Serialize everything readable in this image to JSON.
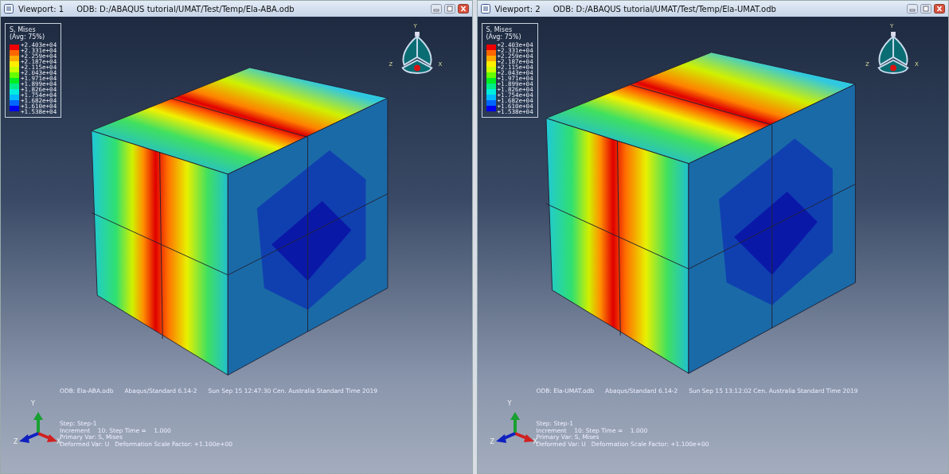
{
  "viewports": [
    {
      "title": "Viewport: 1",
      "odb_path": "ODB: D:/ABAQUS tutorial/UMAT/Test/Temp/Ela-ABA.odb",
      "legend": {
        "title": "S, Mises",
        "subtitle": "(Avg: 75%)",
        "bands": [
          {
            "color": "#ee0000"
          },
          {
            "color": "#ff6600"
          },
          {
            "color": "#ffaa00"
          },
          {
            "color": "#ffee00"
          },
          {
            "color": "#ccff00"
          },
          {
            "color": "#66ff00"
          },
          {
            "color": "#00ee22"
          },
          {
            "color": "#00ee88"
          },
          {
            "color": "#00eedd"
          },
          {
            "color": "#00bbff"
          },
          {
            "color": "#0066ff"
          },
          {
            "color": "#0000ee"
          }
        ],
        "values": [
          "+2.403e+04",
          "+2.331e+04",
          "+2.259e+04",
          "+2.187e+04",
          "+2.115e+04",
          "+2.043e+04",
          "+1.971e+04",
          "+1.899e+04",
          "+1.826e+04",
          "+1.754e+04",
          "+1.682e+04",
          "+1.610e+04",
          "+1.538e+04"
        ]
      },
      "view_cube": {
        "y": "Y",
        "z": "Z",
        "x": "X"
      },
      "info_line": [
        "ODB: Ela-ABA.odb",
        "Abaqus/Standard 6.14-2",
        "Sun Sep 15 12:47:30 Cen. Australia Standard Time 2019"
      ],
      "step_lines": [
        "Step: Step-1",
        "Increment    10: Step Time =    1.000",
        "Primary Var: S, Mises",
        "Deformed Var: U   Deformation Scale Factor: +1.100e+00"
      ],
      "triad": {
        "y": "Y",
        "z": "Z",
        "x": "X"
      }
    },
    {
      "title": "Viewport: 2",
      "odb_path": "ODB: D:/ABAQUS tutorial/UMAT/Test/Temp/Ela-UMAT.odb",
      "legend": {
        "title": "S, Mises",
        "subtitle": "(Avg: 75%)",
        "bands": [
          {
            "color": "#ee0000"
          },
          {
            "color": "#ff6600"
          },
          {
            "color": "#ffaa00"
          },
          {
            "color": "#ffee00"
          },
          {
            "color": "#ccff00"
          },
          {
            "color": "#66ff00"
          },
          {
            "color": "#00ee22"
          },
          {
            "color": "#00ee88"
          },
          {
            "color": "#00eedd"
          },
          {
            "color": "#00bbff"
          },
          {
            "color": "#0066ff"
          },
          {
            "color": "#0000ee"
          }
        ],
        "values": [
          "+2.403e+04",
          "+2.331e+04",
          "+2.259e+04",
          "+2.187e+04",
          "+2.115e+04",
          "+2.043e+04",
          "+1.971e+04",
          "+1.899e+04",
          "+1.826e+04",
          "+1.754e+04",
          "+1.682e+04",
          "+1.610e+04",
          "+1.538e+04"
        ]
      },
      "view_cube": {
        "y": "Y",
        "z": "Z",
        "x": "X"
      },
      "info_line": [
        "ODB: Ela-UMAT.odb",
        "Abaqus/Standard 6.14-2",
        "Sun Sep 15 13:12:02 Cen. Australia Standard Time 2019"
      ],
      "step_lines": [
        "Step: Step-1",
        "Increment    10: Step Time =    1.000",
        "Primary Var: S, Mises",
        "Deformed Var: U   Deformation Scale Factor: +1.100e+00"
      ],
      "triad": {
        "y": "Y",
        "z": "Z",
        "x": "X"
      }
    }
  ]
}
